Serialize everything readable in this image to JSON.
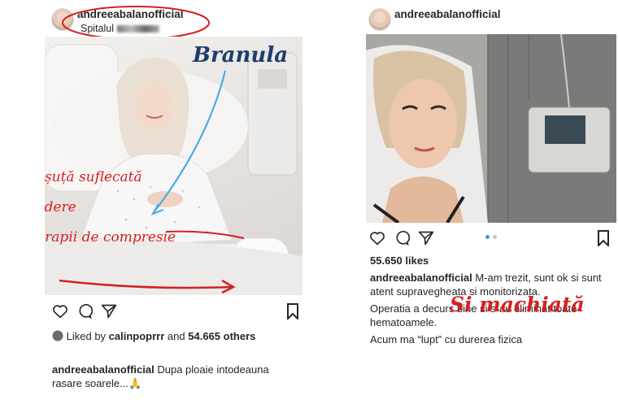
{
  "left_post": {
    "username": "andreeabalanofficial",
    "location_prefix": "Spitalul",
    "annotation_label": "Branula",
    "annotation_lines": [
      "cămășuță suflecată",
      "cu vedere",
      "la ciorapii de compresie"
    ],
    "liked_by_prefix": "Liked by",
    "liked_by_user": "calinpoprrr",
    "liked_by_and": "and",
    "liked_by_count": "54.665",
    "liked_by_others": "others",
    "caption_user": "andreeabalanofficial",
    "caption_text": "Dupa ploaie intodeauna rasare soarele...",
    "caption_emoji": "🙏"
  },
  "right_post": {
    "username": "andreeabalanofficial",
    "likes": "55.650 likes",
    "annotation": "Si machiată",
    "caption_user": "andreeabalanofficial",
    "caption_text": "M-am trezit, sunt ok si sunt atent supravegheata si monitorizata.",
    "caption_line2": "Operatia a decurs bine si s-au eliminat toate hematoamele.",
    "caption_line3": "Acum ma “lupt” cu durerea fizica"
  },
  "colors": {
    "annotation_red": "#d62020",
    "annotation_blue": "#3fa6e6",
    "carousel_active": "#3897f0"
  },
  "icons": [
    "heart-icon",
    "comment-icon",
    "share-icon",
    "bookmark-icon"
  ]
}
